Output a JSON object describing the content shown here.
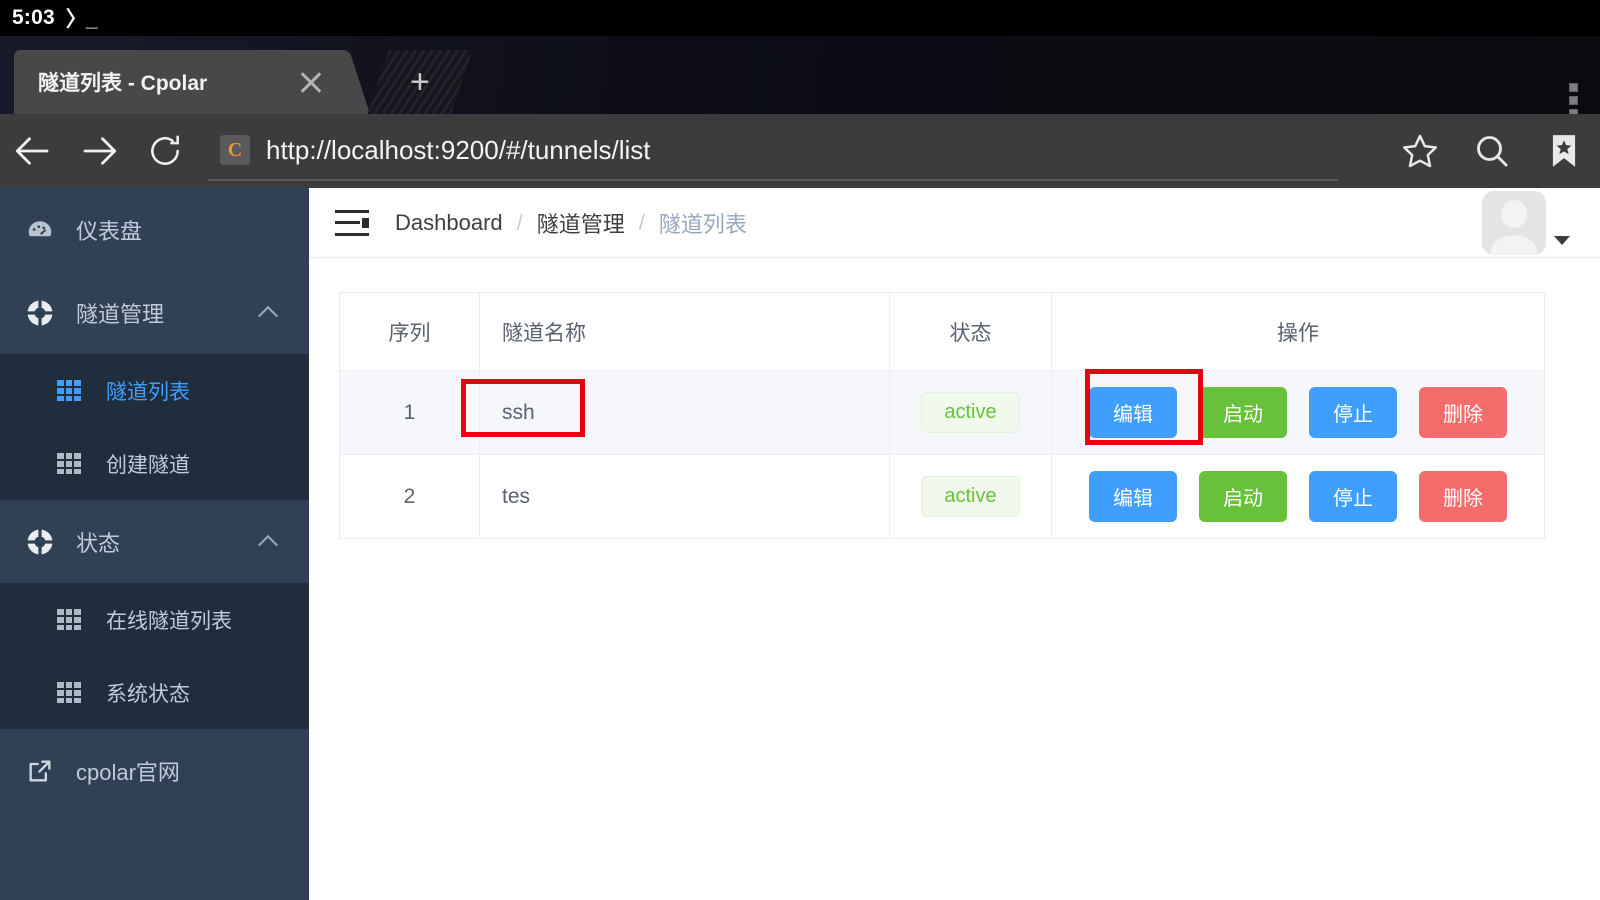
{
  "status_bar": {
    "time": "5:03",
    "terminal_glyph": "〉_"
  },
  "browser": {
    "tab": {
      "title": "隧道列表 - Cpolar",
      "close_icon": "close-icon"
    },
    "new_tab_label": "+",
    "menu_icon": "overflow-menu-icon",
    "url": "http://localhost:9200/#/tunnels/list",
    "favicon_letter": "C",
    "nav": {
      "back": "back-arrow-icon",
      "forward": "forward-arrow-icon",
      "reload": "reload-icon"
    },
    "actions": {
      "bookmark_star": "star-outline-icon",
      "search": "search-icon",
      "reading_list": "bookmark-star-icon"
    }
  },
  "sidebar": {
    "items": [
      {
        "label": "仪表盘",
        "icon": "gauge-icon",
        "type": "item"
      },
      {
        "label": "隧道管理",
        "icon": "lifebuoy-icon",
        "type": "group",
        "expanded": true,
        "children": [
          {
            "label": "隧道列表",
            "icon": "grid-icon",
            "active": true
          },
          {
            "label": "创建隧道",
            "icon": "grid-icon",
            "active": false
          }
        ]
      },
      {
        "label": "状态",
        "icon": "lifebuoy-icon",
        "type": "group",
        "expanded": true,
        "children": [
          {
            "label": "在线隧道列表",
            "icon": "grid-icon",
            "active": false
          },
          {
            "label": "系统状态",
            "icon": "grid-icon",
            "active": false
          }
        ]
      },
      {
        "label": "cpolar官网",
        "icon": "external-link-icon",
        "type": "item"
      }
    ]
  },
  "navbar": {
    "hamburger_icon": "collapse-menu-icon",
    "breadcrumb": [
      {
        "label": "Dashboard",
        "current": false
      },
      {
        "label": "隧道管理",
        "current": false
      },
      {
        "label": "隧道列表",
        "current": true
      }
    ],
    "separator": "/",
    "avatar_icon": "user-avatar-placeholder",
    "caret_icon": "chevron-down-icon"
  },
  "table": {
    "columns": [
      "序列",
      "隧道名称",
      "状态",
      "操作"
    ],
    "rows": [
      {
        "seq": "1",
        "name": "ssh",
        "state": "active",
        "highlighted": true
      },
      {
        "seq": "2",
        "name": "tes",
        "state": "active",
        "highlighted": false
      }
    ],
    "actions": {
      "edit": "编辑",
      "start": "启动",
      "stop": "停止",
      "delete": "删除"
    }
  },
  "colors": {
    "sidebar_bg": "#304156",
    "submenu_bg": "#1f2d3d",
    "accent_blue": "#409eff",
    "success_green": "#67c23a",
    "danger_red": "#f56c6c",
    "annotation_red": "#e60012",
    "badge_bg": "#f0f9eb"
  },
  "annotations": [
    {
      "name": "ssh-name-cell-highlight"
    },
    {
      "name": "edit-button-highlight"
    }
  ]
}
